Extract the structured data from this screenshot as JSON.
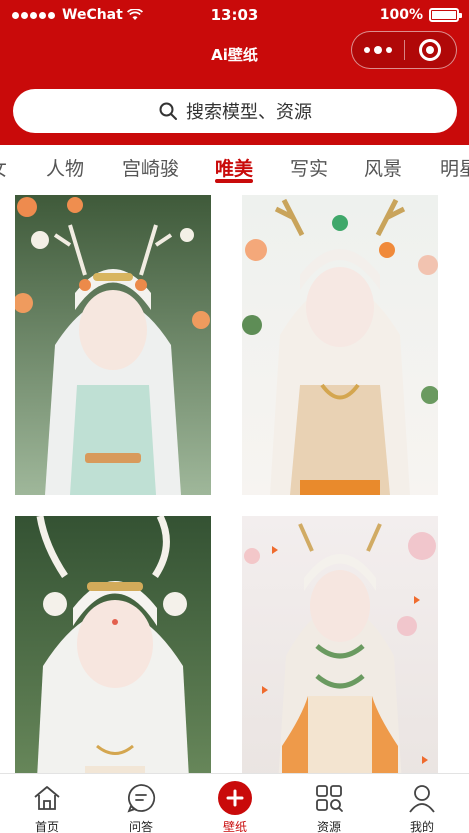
{
  "status_bar": {
    "carrier": "WeChat",
    "time": "13:03",
    "battery": "100%"
  },
  "nav": {
    "title": "Ai壁纸"
  },
  "search": {
    "placeholder": "搜索模型、资源"
  },
  "tabs": [
    {
      "label": "女"
    },
    {
      "label": "人物"
    },
    {
      "label": "宫崎骏"
    },
    {
      "label": "唯美",
      "active": true
    },
    {
      "label": "写实"
    },
    {
      "label": "风景"
    },
    {
      "label": "明星"
    }
  ],
  "wallpapers": [
    {
      "icon": "wallpaper-image"
    },
    {
      "icon": "wallpaper-image"
    },
    {
      "icon": "wallpaper-image"
    },
    {
      "icon": "wallpaper-image"
    }
  ],
  "bottom_nav": [
    {
      "label": "首页",
      "icon": "home-icon"
    },
    {
      "label": "问答",
      "icon": "chat-icon"
    },
    {
      "label": "壁纸",
      "icon": "plus-icon",
      "active": true
    },
    {
      "label": "资源",
      "icon": "grid-search-icon"
    },
    {
      "label": "我的",
      "icon": "user-icon"
    }
  ],
  "colors": {
    "accent": "#c90a0a"
  }
}
